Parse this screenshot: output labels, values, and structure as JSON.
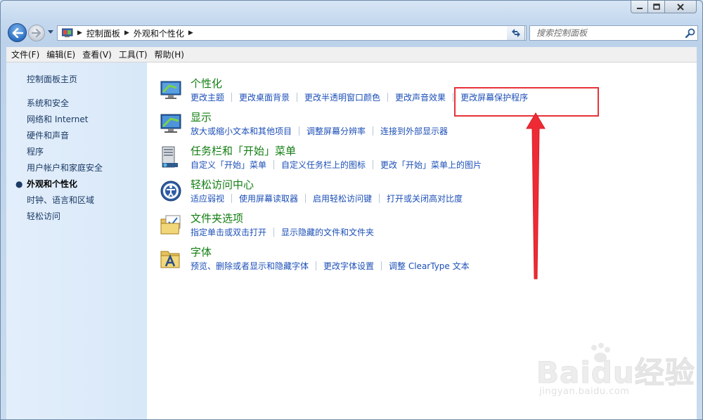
{
  "window": {
    "caption_buttons": [
      "minimize-icon",
      "maximize-icon",
      "close-icon"
    ]
  },
  "navigation": {
    "breadcrumbs": [
      "控制面板",
      "外观和个性化"
    ],
    "search_placeholder": "搜索控制面板"
  },
  "menubar": {
    "items": [
      "文件(F)",
      "编辑(E)",
      "查看(V)",
      "工具(T)",
      "帮助(H)"
    ]
  },
  "sidebar": {
    "home": "控制面板主页",
    "items": [
      {
        "label": "系统和安全",
        "active": false
      },
      {
        "label": "网络和 Internet",
        "active": false
      },
      {
        "label": "硬件和声音",
        "active": false
      },
      {
        "label": "程序",
        "active": false
      },
      {
        "label": "用户帐户和家庭安全",
        "active": false
      },
      {
        "label": "外观和个性化",
        "active": true
      },
      {
        "label": "时钟、语言和区域",
        "active": false
      },
      {
        "label": "轻松访问",
        "active": false
      }
    ]
  },
  "sections": [
    {
      "title": "个性化",
      "icon": "personalization-icon",
      "links": [
        "更改主题",
        "更改桌面背景",
        "更改半透明窗口颜色",
        "更改声音效果",
        "更改屏幕保护程序"
      ]
    },
    {
      "title": "显示",
      "icon": "display-icon",
      "links": [
        "放大或缩小文本和其他项目",
        "调整屏幕分辨率",
        "连接到外部显示器"
      ]
    },
    {
      "title": "任务栏和「开始」菜单",
      "icon": "taskbar-icon",
      "links": [
        "自定义「开始」菜单",
        "自定义任务栏上的图标",
        "更改「开始」菜单上的图片"
      ]
    },
    {
      "title": "轻松访问中心",
      "icon": "ease-of-access-icon",
      "links": [
        "适应弱视",
        "使用屏幕读取器",
        "启用轻松访问键",
        "打开或关闭高对比度"
      ]
    },
    {
      "title": "文件夹选项",
      "icon": "folder-options-icon",
      "links": [
        "指定单击或双击打开",
        "显示隐藏的文件和文件夹"
      ]
    },
    {
      "title": "字体",
      "icon": "fonts-icon",
      "links": [
        "预览、删除或者显示和隐藏字体",
        "更改字体设置",
        "调整 ClearType 文本"
      ]
    }
  ],
  "annotation": {
    "highlight_color": "#e8323a"
  },
  "watermark": {
    "brand": "Baidu经验",
    "url": "jingyan.baidu.com"
  },
  "colors": {
    "section_title": "#127e12",
    "link": "#1c4fb7",
    "sidebar_text": "#1b3b66"
  }
}
